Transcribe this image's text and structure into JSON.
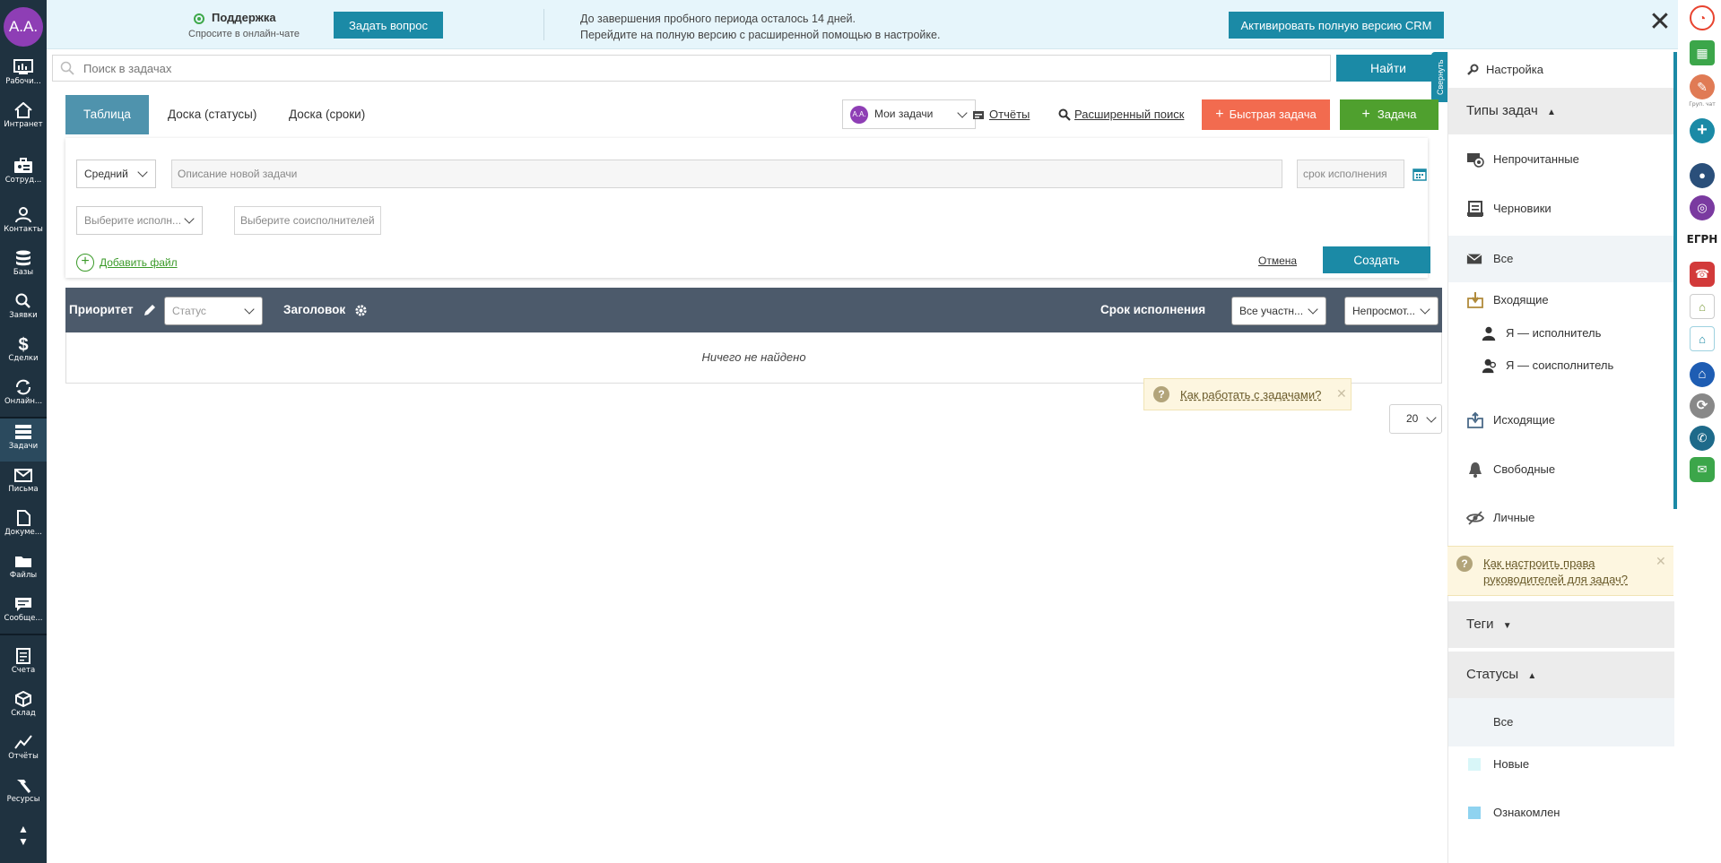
{
  "user": {
    "initials": "A.A."
  },
  "leftnav": {
    "items": [
      {
        "label": "Рабочи...",
        "icon": "dashboard-icon"
      },
      {
        "label": "Интранет",
        "icon": "home-icon"
      },
      {
        "label": "Сотруд...",
        "icon": "employees-icon"
      },
      {
        "label": "Контакты",
        "icon": "contacts-icon"
      },
      {
        "label": "Базы",
        "icon": "databases-icon"
      },
      {
        "label": "Заявки",
        "icon": "search-requests-icon"
      },
      {
        "label": "Сделки",
        "icon": "deals-icon"
      },
      {
        "label": "Онлайн...",
        "icon": "online-icon"
      },
      {
        "label": "Задачи",
        "icon": "tasks-icon"
      },
      {
        "label": "Письма",
        "icon": "mail-icon"
      },
      {
        "label": "Докуме...",
        "icon": "documents-icon"
      },
      {
        "label": "Файлы",
        "icon": "files-icon"
      },
      {
        "label": "Сообще...",
        "icon": "messages-icon"
      },
      {
        "label": "Счета",
        "icon": "invoices-icon"
      },
      {
        "label": "Склад",
        "icon": "warehouse-icon"
      },
      {
        "label": "Отчёты",
        "icon": "reports-icon"
      },
      {
        "label": "Ресурсы",
        "icon": "resources-icon"
      }
    ],
    "arrows": {
      "up": "▲",
      "down": "▼"
    }
  },
  "banner": {
    "support_title": "Поддержка",
    "support_sub": "Спросите в онлайн-чате",
    "ask_button": "Задать вопрос",
    "trial_line1": "До завершения пробного периода осталось 14 дней.",
    "trial_line2": "Перейдите на полную версию с расширенной помощью в настройке.",
    "activate_button": "Активировать полную версию CRM",
    "close": "✕"
  },
  "search": {
    "placeholder": "Поиск в задачах",
    "find_button": "Найти",
    "collapse_label": "Свернуть"
  },
  "tabs": [
    {
      "label": "Таблица",
      "active": true
    },
    {
      "label": "Доска (статусы)",
      "active": false
    },
    {
      "label": "Доска (сроки)",
      "active": false
    }
  ],
  "toolbar": {
    "my_tasks_avatar": "A.A.",
    "my_tasks": "Мои задачи",
    "reports": "Отчёты",
    "advanced_search": "Расширенный поиск",
    "quick_task": "Быстрая задача",
    "task": "Задача"
  },
  "form": {
    "priority": "Средний",
    "description_placeholder": "Описание новой задачи",
    "deadline_placeholder": "срок исполнения",
    "executor_placeholder": "Выберите исполн...",
    "coexecutor_placeholder": "Выберите соисполнителей",
    "add_file": "Добавить файл",
    "cancel": "Отмена",
    "create": "Создать"
  },
  "table": {
    "col_priority": "Приоритет",
    "col_status_placeholder": "Статус",
    "col_title": "Заголовок",
    "col_deadline": "Срок исполнения",
    "participants_filter": "Все участн...",
    "viewed_filter": "Непросмот...",
    "empty": "Ничего не найдено"
  },
  "help_tasks": "Как работать с задачами?",
  "per_page": "20",
  "sidebar": {
    "settings": "Настройка",
    "types_header": "Типы задач",
    "types": [
      {
        "label": "Непрочитанные",
        "icon": "unread-icon"
      },
      {
        "label": "Черновики",
        "icon": "drafts-icon"
      },
      {
        "label": "Все",
        "icon": "envelope-icon",
        "selected": true
      },
      {
        "label": "Входящие",
        "icon": "inbox-icon"
      },
      {
        "label": "Я — исполнитель",
        "icon": "person-icon",
        "sub": true
      },
      {
        "label": "Я — соисполнитель",
        "icon": "persons-icon",
        "sub": true
      },
      {
        "label": "Исходящие",
        "icon": "outbox-icon"
      },
      {
        "label": "Свободные",
        "icon": "bell-icon"
      },
      {
        "label": "Личные",
        "icon": "hidden-eye-icon"
      }
    ],
    "rights_help": "Как настроить права руководителей для задач?",
    "tags_header": "Теги",
    "statuses_header": "Статусы",
    "statuses": [
      {
        "label": "Все",
        "color": ""
      },
      {
        "label": "Новые",
        "color": "#d8f6f8"
      },
      {
        "label": "Ознакомлен",
        "color": "#8fd3f0"
      }
    ]
  },
  "rstrip": {
    "egrn_label": "ЕГРН",
    "chat_label": "Груп. чат"
  },
  "colors": {
    "nav_bg": "#1f3240",
    "accent": "#1b8aa6",
    "quick_task": "#f26b4f",
    "task": "#4fa02e",
    "table_header": "#4c5a6b",
    "avatar": "#8e3eb5"
  }
}
